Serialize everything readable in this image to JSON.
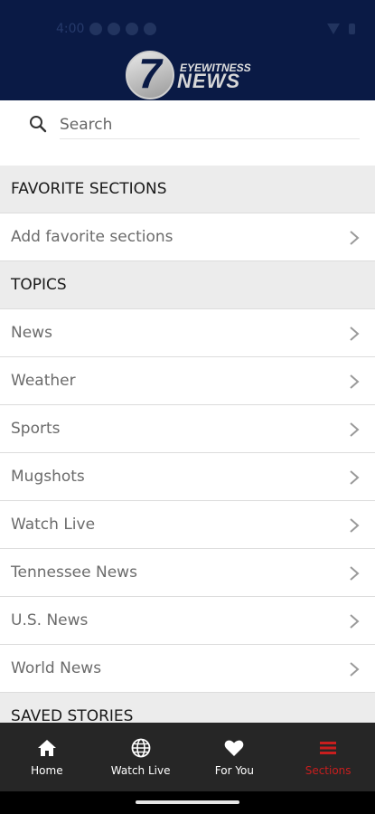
{
  "status_bar": {
    "time": "4:00"
  },
  "header": {
    "logo_number": "7",
    "logo_line1": "EYEWITNESS",
    "logo_line2": "NEWS"
  },
  "search": {
    "placeholder": "Search"
  },
  "favorites": {
    "title": "FAVORITE SECTIONS",
    "add_label": "Add favorite sections"
  },
  "topics": {
    "title": "TOPICS",
    "items": [
      "News",
      "Weather",
      "Sports",
      "Mugshots",
      "Watch Live",
      "Tennessee News",
      "U.S. News",
      "World News"
    ]
  },
  "saved": {
    "title": "SAVED STORIES"
  },
  "bottom_nav": {
    "tabs": [
      {
        "label": "Home",
        "icon": "home-icon"
      },
      {
        "label": "Watch Live",
        "icon": "globe-icon"
      },
      {
        "label": "For You",
        "icon": "heart-icon"
      },
      {
        "label": "Sections",
        "icon": "sections-icon"
      }
    ],
    "active_tab": "Sections"
  },
  "colors": {
    "header_bg": "#0a1a45",
    "nav_bg": "#262626",
    "active": "#c81e1e",
    "section_bg": "#ececec"
  }
}
